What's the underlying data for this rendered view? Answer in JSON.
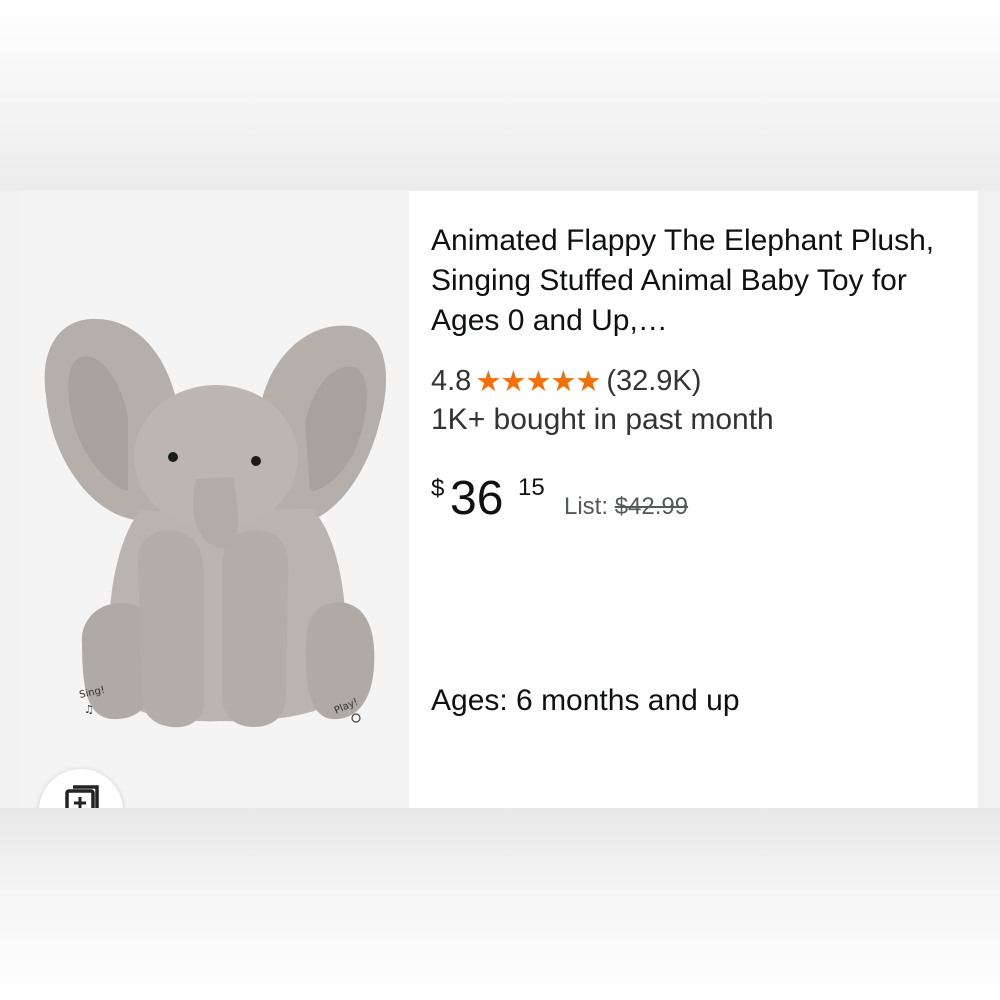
{
  "product": {
    "title": "Animated Flappy The Elephant Plush, Singing Stuffed Animal Baby Toy for Ages 0 and Up,…",
    "rating_value": "4.8",
    "stars": "★★★★★",
    "rating_count": "(32.9K)",
    "bought": "1K+ bought in past month",
    "price": {
      "currency": "$",
      "whole": "36",
      "fraction": "15",
      "list_label": "List:",
      "list_price": "$42.99"
    },
    "ages": "Ages: 6 months and up",
    "image": {
      "left_paw_text": "Sing!",
      "left_paw_icon": "music-note-icon",
      "right_paw_text": "Play!",
      "right_paw_icon": "swirl-icon"
    }
  },
  "compare_button_icon": "compare-images-icon",
  "colors": {
    "star": "#f26f0a",
    "text": "#0f1111",
    "secondary_text": "#565959",
    "plush": "#b7b1ae"
  }
}
